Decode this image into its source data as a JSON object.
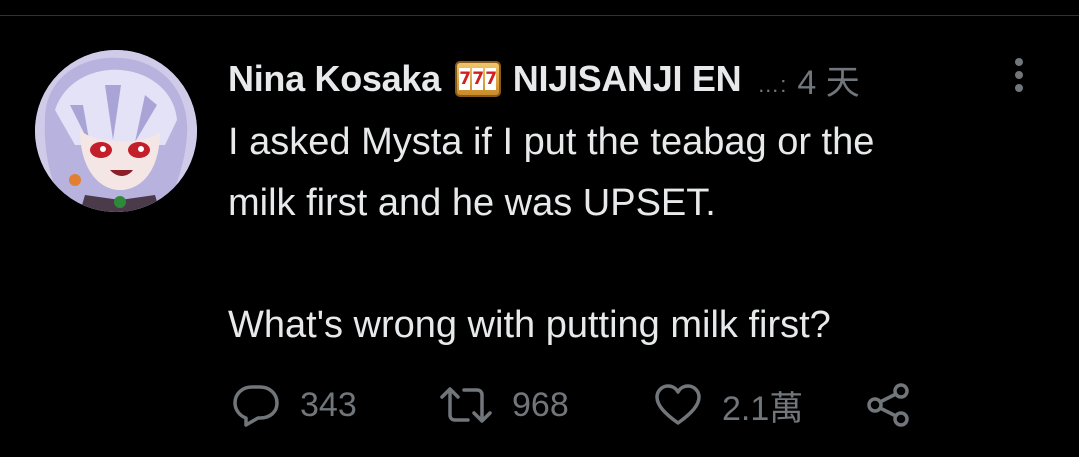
{
  "tweet": {
    "author": {
      "display_name": "Nina Kosaka",
      "badge_emoji": "slot-machine-777",
      "badge_digits": [
        "7",
        "7",
        "7"
      ],
      "name_suffix": "NIJISANJI EN",
      "truncation": "…:"
    },
    "timestamp": "4 天",
    "text": "I asked Mysta if I put the teabag or the\nmilk first and he was UPSET.\n\nWhat's wrong with putting milk first?",
    "actions": {
      "reply": {
        "icon": "reply-icon",
        "count": "343"
      },
      "retweet": {
        "icon": "retweet-icon",
        "count": "968"
      },
      "like": {
        "icon": "heart-icon",
        "count": "2.1萬"
      },
      "share": {
        "icon": "share-icon"
      }
    }
  },
  "colors": {
    "background": "#000000",
    "primary_text": "#e7e9ea",
    "secondary_text": "#71767b",
    "divider": "#2f3336"
  }
}
